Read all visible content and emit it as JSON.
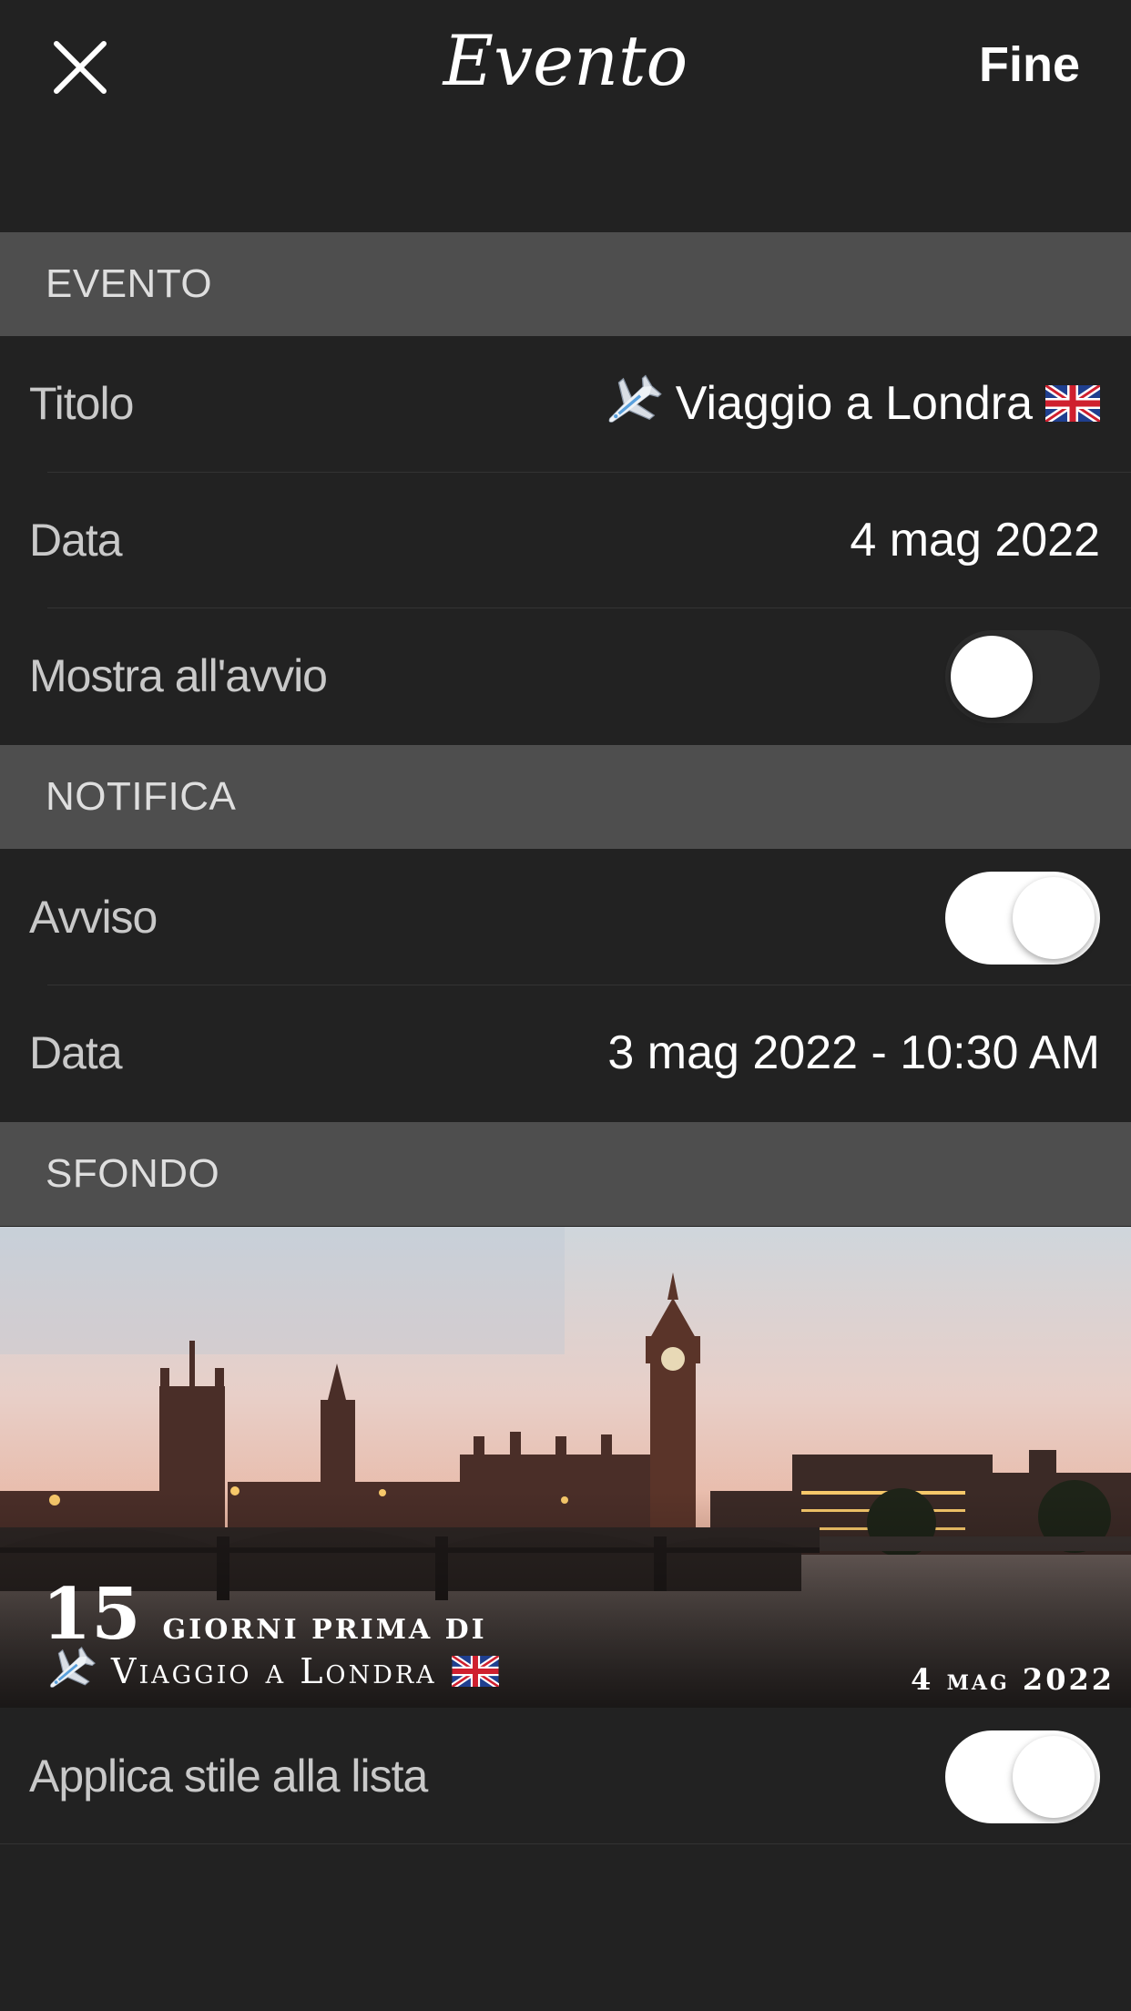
{
  "nav": {
    "title": "Evento",
    "done_label": "Fine"
  },
  "sections": {
    "event": "EVENTO",
    "notification": "NOTIFICA",
    "background": "SFONDO"
  },
  "event": {
    "title_label": "Titolo",
    "title_value": "Viaggio a Londra",
    "date_label": "Data",
    "date_value": "4 mag 2022",
    "show_on_launch_label": "Mostra all'avvio",
    "show_on_launch": false
  },
  "notification": {
    "alert_label": "Avviso",
    "alert_enabled": true,
    "date_label": "Data",
    "date_value": "3 mag 2022 - 10:30 AM"
  },
  "background": {
    "days_count": "15",
    "days_text": "giorni prima di",
    "event_title": "Viaggio a Londra",
    "event_date": "4 mag 2022"
  },
  "apply_style": {
    "label": "Applica stile alla lista",
    "enabled": true
  },
  "icons": {
    "close": "close-icon",
    "airplane": "airplane-icon",
    "flag": "uk-flag-icon"
  },
  "colors": {
    "background": "#222222",
    "section_header": "#4e4e4e",
    "text": "#ffffff",
    "label": "#c9c9c9"
  }
}
